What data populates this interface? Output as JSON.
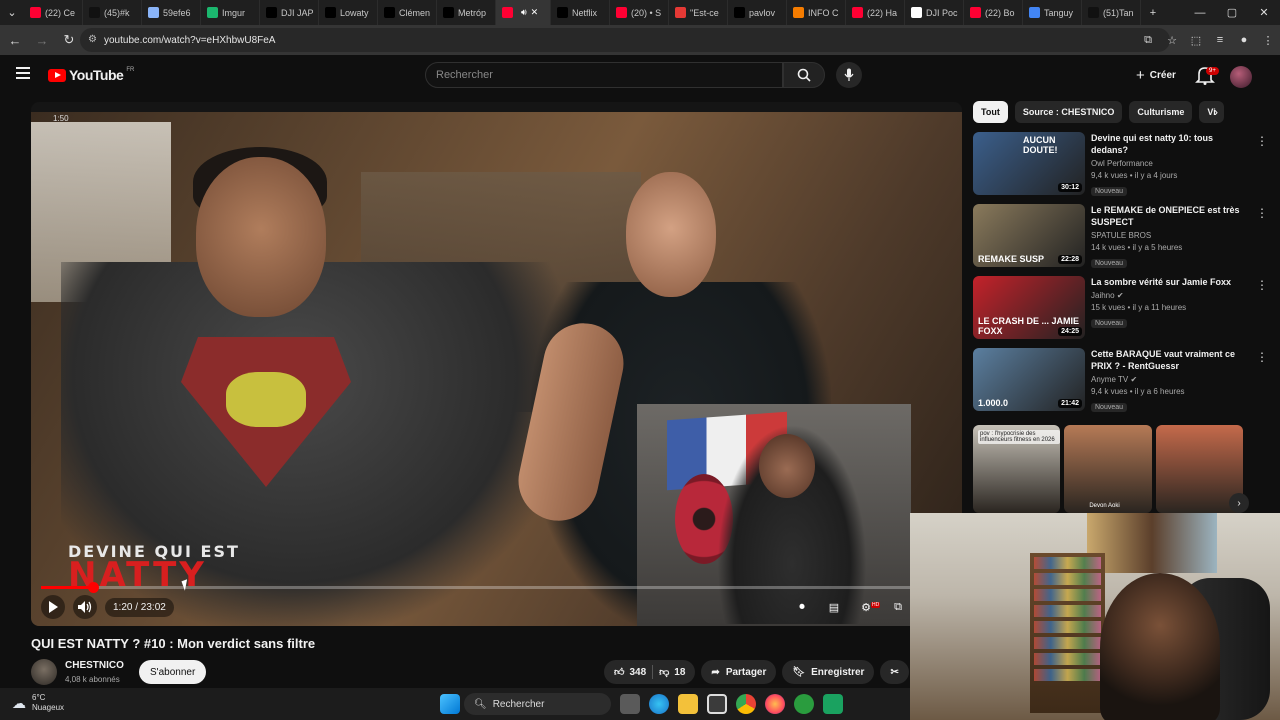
{
  "browser": {
    "tabs": [
      {
        "label": "(22) Ce",
        "icon": "youtube-icon",
        "color": "#ff0033"
      },
      {
        "label": "(45)#k",
        "icon": "tiktok-icon",
        "color": "#111111"
      },
      {
        "label": "59efe6",
        "icon": "globe-icon",
        "color": "#8ab4f8"
      },
      {
        "label": "Imgur",
        "icon": "imgur-icon",
        "color": "#1bb76e"
      },
      {
        "label": "DJI JAP",
        "icon": "x-icon",
        "color": "#000000"
      },
      {
        "label": "Lowaty",
        "icon": "x-icon",
        "color": "#000000"
      },
      {
        "label": "Clémen",
        "icon": "x-icon",
        "color": "#000000"
      },
      {
        "label": "Metróp",
        "icon": "x-icon",
        "color": "#000000"
      },
      {
        "label": "",
        "icon": "youtube-icon",
        "color": "#ff0033",
        "active": true
      },
      {
        "label": "Netflix",
        "icon": "x-icon",
        "color": "#000000"
      },
      {
        "label": "(20) • S",
        "icon": "youtube-icon",
        "color": "#ff0033"
      },
      {
        "label": "\"Est-ce",
        "icon": "e-icon",
        "color": "#e53935"
      },
      {
        "label": "pavlov",
        "icon": "x-icon",
        "color": "#000000"
      },
      {
        "label": "INFO C",
        "icon": "rss-icon",
        "color": "#f57c00"
      },
      {
        "label": "(22) Ha",
        "icon": "youtube-icon",
        "color": "#ff0033"
      },
      {
        "label": "DJI Poc",
        "icon": "dji-icon",
        "color": "#ffffff"
      },
      {
        "label": "(22) Bo",
        "icon": "youtube-icon",
        "color": "#ff0033"
      },
      {
        "label": "Tanguy",
        "icon": "google-icon",
        "color": "#4285f4"
      },
      {
        "label": "(51)Tan",
        "icon": "tiktok-icon",
        "color": "#111111"
      }
    ],
    "url": "youtube.com/watch?v=eHXhbwU8FeA"
  },
  "youtube": {
    "logo_text": "YouTube",
    "region": "FR",
    "search_placeholder": "Rechercher",
    "create_label": "Créer",
    "notif_badge": "9+",
    "video": {
      "overlay_counter": "1:50",
      "art_line1": "DEVINE QUI EST",
      "art_line2": "NATTY",
      "time": "1:20 / 23:02",
      "progress": 0.058,
      "title": "QUI EST NATTY ? #10 : Mon verdict sans filtre",
      "channel": "CHESTNICO",
      "subscribers": "4,08 k abonnés",
      "subscribe_label": "S'abonner",
      "likes": "348",
      "dislikes": "18",
      "share_label": "Partager",
      "save_label": "Enregistrer"
    },
    "chips": [
      "Tout",
      "Source : CHESTNICO",
      "Culturisme",
      "Vi"
    ],
    "recommendations": [
      {
        "title": "Devine qui est natty 10: tous dedans?",
        "channel": "Owl Performance",
        "meta": "9,4 k vues • il y a 4 jours",
        "badge": "Nouveau",
        "duration": "30:12",
        "thumb_text": "AUCUN DOUTE!",
        "thumb_color": "#3b5f8c",
        "verified": false
      },
      {
        "title": "Le REMAKE de ONEPIECE est très SUSPECT",
        "channel": "SPATULE BROS",
        "meta": "14 k vues • il y a 5 heures",
        "badge": "Nouveau",
        "duration": "22:28",
        "thumb_text": "REMAKE SUSP",
        "thumb_color": "#8a7a5c",
        "verified": false
      },
      {
        "title": "La sombre vérité sur Jamie Foxx",
        "channel": "Jaihno",
        "meta": "15 k vues • il y a 11 heures",
        "badge": "Nouveau",
        "duration": "24:25",
        "thumb_text": "LE CRASH DE ... JAMIE FOXX",
        "thumb_color": "#c4222a",
        "verified": true
      },
      {
        "title": "Cette BARAQUE vaut vraiment ce PRIX ? - RentGuessr",
        "channel": "Anyme TV",
        "meta": "9,4 k vues • il y a 6 heures",
        "badge": "Nouveau",
        "duration": "21:42",
        "thumb_text": "1.000.0",
        "thumb_color": "#5b7fa0",
        "verified": true
      }
    ],
    "shorts": [
      {
        "caption": "pov : l'hypocrisie des influenceurs fitness en 2026",
        "name": "",
        "color": "#c7c2b8"
      },
      {
        "caption": "",
        "name": "Devon Aoki",
        "color": "#b67a56"
      },
      {
        "caption": "",
        "name": "",
        "color": "#c56a4b"
      }
    ]
  },
  "taskbar": {
    "temperature": "6°C",
    "weather": "Nuageux",
    "search": "Rechercher"
  }
}
